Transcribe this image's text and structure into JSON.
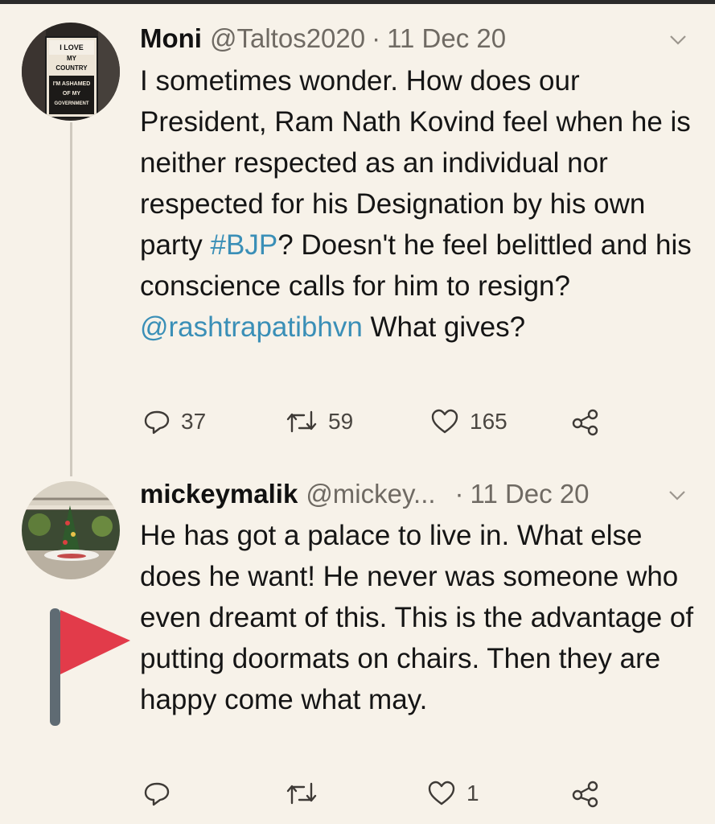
{
  "tweets": [
    {
      "name": "Moni",
      "handle": "@Taltos2020",
      "separator": "·",
      "date": "11 Dec 20",
      "text_before_hashtag": "I sometimes wonder. How does our President, Ram Nath Kovind feel when he is neither respected as an individual nor respected for his Designation by his own party ",
      "hashtag": "#BJP",
      "text_before_mention": "? Doesn't he feel belittled and his conscience calls for him to resign? ",
      "mention": "@rashtrapatibhvn",
      "text_after_mention": " What gives?",
      "reply_count": "37",
      "retweet_count": "59",
      "like_count": "165",
      "avatar_sign_text": [
        "I LOVE",
        "MY",
        "COUNTRY",
        "I'M ASHAMED",
        "OF MY",
        "GOVERNMENT"
      ]
    },
    {
      "name": "mickeymalik",
      "handle": "@mickey...",
      "separator": "·",
      "date": "11 Dec 20",
      "text": "He has got a palace to live in. What else does he want! He never was someone who even dreamt of this. This is the advantage of putting doormats on chairs. Then they are happy come what may.",
      "reply_count": "",
      "retweet_count": "",
      "like_count": "1"
    }
  ],
  "icons": {
    "reply": "reply-icon",
    "retweet": "retweet-icon",
    "like": "heart-icon",
    "share": "share-icon",
    "caret": "chevron-down-icon",
    "flag": "red-flag-icon"
  },
  "colors": {
    "background": "#f7f2e9",
    "link": "#3a8fb7",
    "secondary_text": "#6f6a63",
    "flag": "#e23b4a",
    "flag_pole": "#5f6b73"
  }
}
